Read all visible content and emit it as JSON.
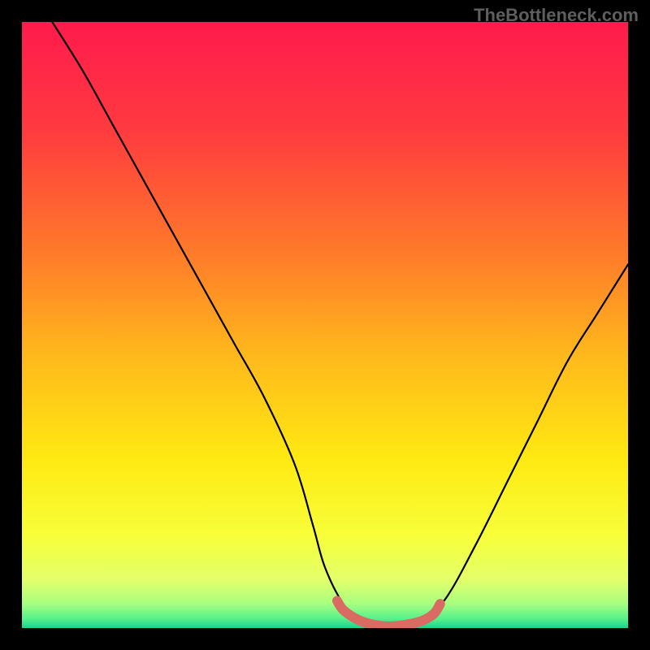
{
  "watermark": "TheBottleneck.com",
  "chart_data": {
    "type": "line",
    "title": "",
    "xlabel": "",
    "ylabel": "",
    "xlim": [
      0,
      100
    ],
    "ylim": [
      0,
      100
    ],
    "gradient_stops": [
      {
        "offset": 0.0,
        "color": "#ff1a4d"
      },
      {
        "offset": 0.18,
        "color": "#ff3b3f"
      },
      {
        "offset": 0.38,
        "color": "#ff7a2a"
      },
      {
        "offset": 0.55,
        "color": "#ffb81c"
      },
      {
        "offset": 0.72,
        "color": "#ffe912"
      },
      {
        "offset": 0.85,
        "color": "#f7ff3a"
      },
      {
        "offset": 0.92,
        "color": "#e3ff6a"
      },
      {
        "offset": 0.96,
        "color": "#a8ff80"
      },
      {
        "offset": 0.985,
        "color": "#55f08c"
      },
      {
        "offset": 1.0,
        "color": "#17d48e"
      }
    ],
    "series": [
      {
        "name": "bottleneck-curve",
        "color": "#000000",
        "x": [
          5,
          10,
          15,
          20,
          25,
          30,
          35,
          40,
          45,
          48,
          50,
          53,
          56,
          60,
          63,
          66,
          70,
          75,
          80,
          85,
          90,
          95,
          100
        ],
        "y": [
          100,
          92,
          83,
          74,
          65,
          56,
          47,
          38,
          27,
          17,
          10,
          4,
          1,
          0,
          0,
          1,
          5,
          14,
          24,
          34,
          44,
          52,
          60
        ]
      },
      {
        "name": "optimal-zone",
        "color": "#d96b63",
        "x": [
          52,
          53,
          55,
          57,
          60,
          63,
          66,
          68,
          69
        ],
        "y": [
          4.5,
          3.0,
          1.6,
          0.8,
          0.3,
          0.5,
          1.2,
          2.4,
          4.0
        ]
      }
    ],
    "annotations": []
  }
}
